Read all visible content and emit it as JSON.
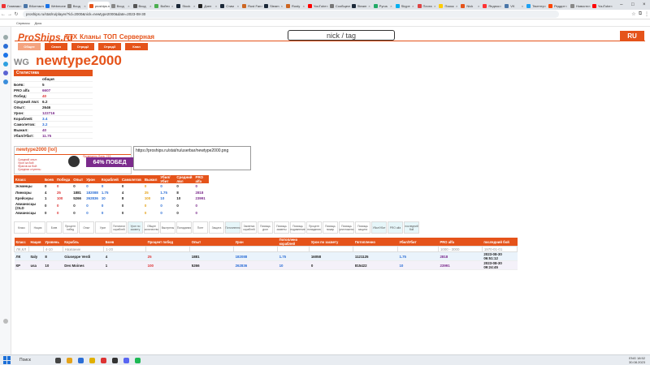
{
  "browser": {
    "tabs": [
      "Главная",
      "ВКонтакте",
      "Webmoney",
      "Вход",
      "proships.ru",
      "Вход",
      "Вход",
      "Войти",
      "Stock",
      "Дзен",
      "Стим",
      "Rust Fan",
      "Steam",
      "Rusty",
      "YouTube",
      "Сообщество",
      "Steam",
      "Pyrus",
      "Skype",
      "Почта",
      "Поиск",
      "Nick",
      "Яндекс",
      "VK",
      "Твиттер",
      "Реддит",
      "Новости",
      "YouTube"
    ],
    "url": "proships.ru/stat/ru/player/?id=2000&nick=newtype2000&date=2023-08-30",
    "bookmarks": [
      "Сервисы",
      "Диск"
    ]
  },
  "site": {
    "logo": "ProShips.ru",
    "nav": [
      "ТТХ",
      "Кланы",
      "ТОП",
      "Серверная"
    ],
    "search_placeholder": "nick / tag",
    "lang": "RU",
    "subnav": [
      "Общее",
      "Сезон",
      "Отряд2",
      "Отряд3",
      "Клан"
    ]
  },
  "player": {
    "server": "WG",
    "name": "newtype2000",
    "stats_title": "Статистика",
    "stats_col": "общая",
    "stats": [
      {
        "k": "Боёв:",
        "v": "5"
      },
      {
        "k": "PRO alfa",
        "v": "6607"
      },
      {
        "k": "Побед:",
        "v": "40"
      },
      {
        "k": "Средний лвл:",
        "v": "6.2"
      },
      {
        "k": "Опыт:",
        "v": "2646"
      },
      {
        "k": "Урон:",
        "v": "122716"
      },
      {
        "k": "Кораблей:",
        "v": "3.4"
      },
      {
        "k": "Самолетов:",
        "v": "3.2"
      },
      {
        "k": "Выжил:",
        "v": "40"
      },
      {
        "k": "Убил/Убит:",
        "v": "11.75"
      }
    ]
  },
  "signature": {
    "title": "newtype2000 [lol]",
    "lines": [
      "Средний опыт:",
      "Урон за бой:",
      "Фрагов за бой:",
      "Средняя ступень:"
    ],
    "header": "Проведено боев: 215",
    "winrate": "64% ПОБЕД",
    "code": "https://proships.ru/stat/ru/userbar/newtype2000.png"
  },
  "class_table": {
    "headers": [
      "Класс",
      "Боев",
      "Победа",
      "Опыт",
      "Урон",
      "Кораблей",
      "Самолетов",
      "Выжил",
      "Убил/Убит",
      "Средний лвл",
      "PRO alfa"
    ],
    "rows": [
      [
        "Эсминцы",
        "0",
        "0",
        "0",
        "0",
        "0",
        "0",
        "0",
        "0",
        "0",
        "0"
      ],
      [
        "Линкоры",
        "4",
        "25",
        "1881",
        "182088",
        "1.75",
        "4",
        "25",
        "1.75",
        "8",
        "2818"
      ],
      [
        "Крейсеры",
        "1",
        "100",
        "5266",
        "262836",
        "10",
        "8",
        "100",
        "10",
        "10",
        "23991"
      ],
      [
        "Авианосцы (OLD",
        "0",
        "0",
        "0",
        "0",
        "0",
        "0",
        "0",
        "0",
        "0",
        "0"
      ],
      [
        "Авианосцы",
        "0",
        "0",
        "0",
        "0",
        "0",
        "0",
        "0",
        "0",
        "0",
        "0"
      ]
    ]
  },
  "filters": [
    "Класс",
    "Нация",
    "Боев",
    "Процент побед",
    "Опыт",
    "Урон",
    "Потопили кораблей",
    "Урон по засвету",
    "Общее количество",
    "Выстрелы",
    "Попадания",
    "Понт",
    "Защита",
    "Потопленно",
    "Засветка кораблей",
    "Помощь урон",
    "Помощь засветы",
    "Помощь подавление",
    "Процент попадания",
    "Помощь пожар",
    "Помощь уничтожено",
    "Помощь защита",
    "Убил/Убит",
    "PRO alfa",
    "последний бой"
  ],
  "ship_table": {
    "headers": [
      "Класс",
      "Нация",
      "Уровень",
      "Корабль",
      "Боев",
      "Процент побед",
      "Опыт",
      "Урон",
      "Потоплено кораблей",
      "Урон по засвету",
      "Потопленно",
      "Убил/Убит",
      "PRO alfa",
      "последний бой"
    ],
    "filter_row": [
      "ЛК,КЛ",
      "",
      "4-10",
      "Название",
      "1-20",
      "",
      "",
      "",
      "",
      "",
      "",
      "",
      "1000 - 3000",
      "1970-01-01"
    ],
    "rows": [
      [
        "ЛК",
        "Italy",
        "8",
        "Giuseppe Verdi",
        "4",
        "25",
        "1881",
        "182088",
        "1.75",
        "16058",
        "1121125",
        "1.75",
        "2818",
        "2023-08-30 06:51:12"
      ],
      [
        "КР",
        "usa",
        "10",
        "Des Moines",
        "1",
        "100",
        "5266",
        "262836",
        "10",
        "0",
        "815422",
        "10",
        "23991",
        "2023-08-30 09:24:45"
      ]
    ]
  },
  "taskbar": {
    "search": "Поиск",
    "time": "18:52",
    "date": "30.08.2023",
    "lang": "ENG"
  }
}
